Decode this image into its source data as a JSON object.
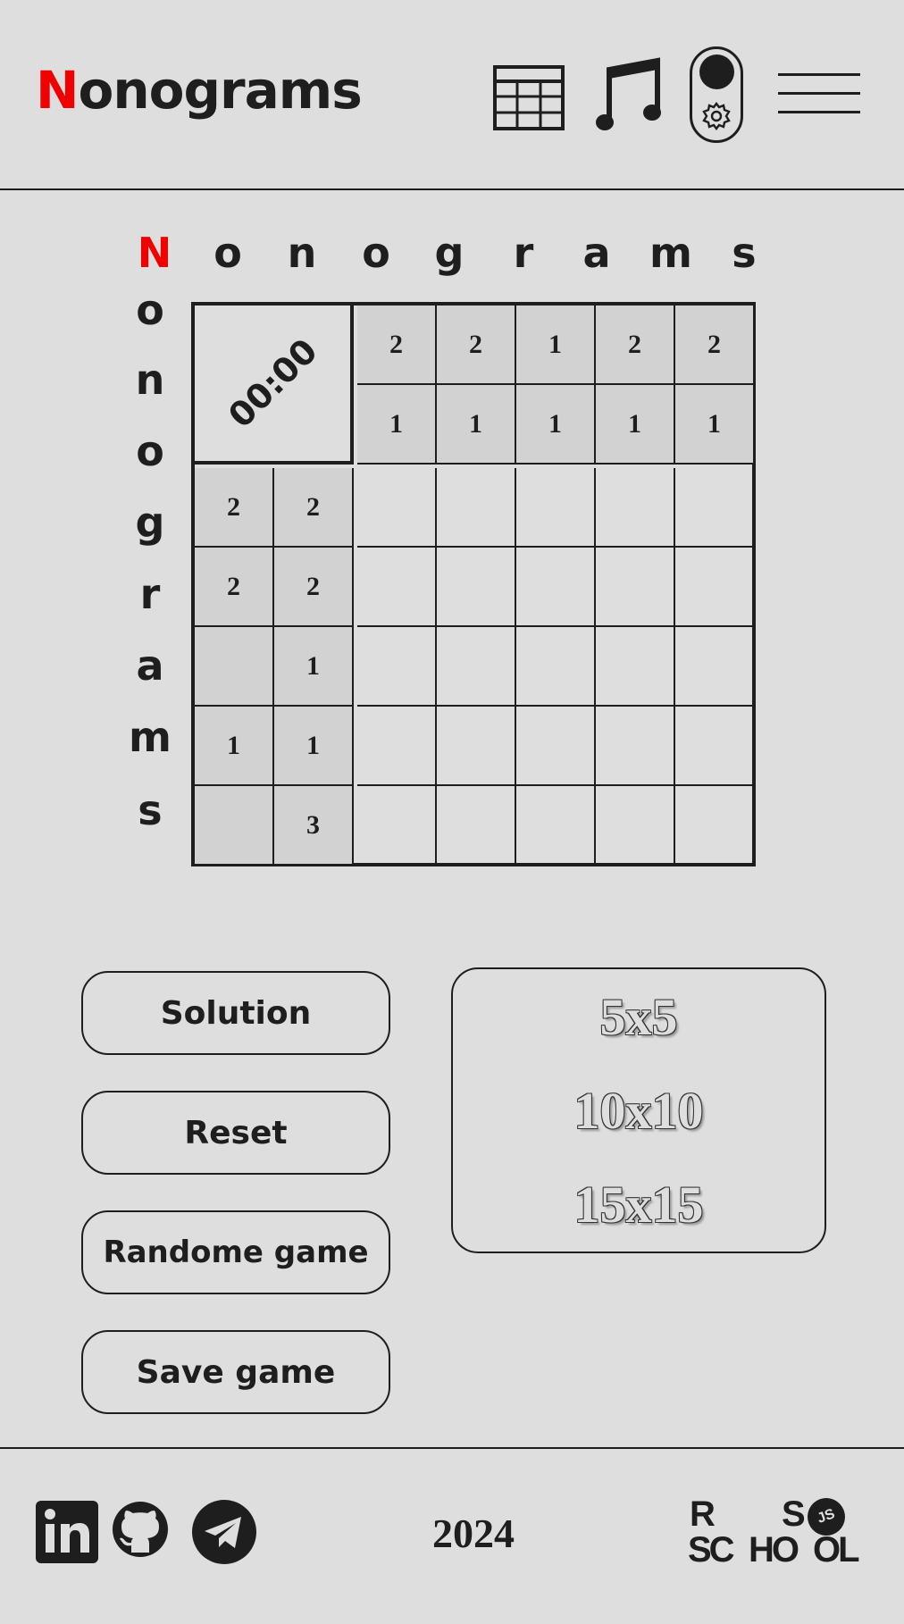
{
  "header": {
    "logo_first": "N",
    "logo_rest": "onograms",
    "icons": [
      "table-icon",
      "music-icon",
      "theme-toggle",
      "menu-icon"
    ]
  },
  "title_letters_top": [
    "N",
    "o",
    "n",
    "o",
    "g",
    "r",
    "a",
    "m",
    "s"
  ],
  "title_letters_side": [
    "o",
    "n",
    "o",
    "g",
    "r",
    "a",
    "m",
    "s"
  ],
  "game": {
    "timer": "00:00",
    "column_clues": [
      [
        "2",
        "1"
      ],
      [
        "2",
        "1"
      ],
      [
        "1",
        "1"
      ],
      [
        "2",
        "1"
      ],
      [
        "2",
        "1"
      ]
    ],
    "row_clues": [
      [
        "2",
        "2"
      ],
      [
        "2",
        "2"
      ],
      [
        "",
        "1"
      ],
      [
        "1",
        "1"
      ],
      [
        "",
        "3"
      ]
    ]
  },
  "buttons": {
    "solution": "Solution",
    "reset": "Reset",
    "random": "Randome game",
    "save": "Save game"
  },
  "sizes": [
    "5x5",
    "10x10",
    "15x15"
  ],
  "footer": {
    "year": "2024",
    "social": [
      "linkedin-icon",
      "github-icon",
      "telegram-icon"
    ],
    "rs_logo": {
      "r": "R",
      "s": "S",
      "school_1": "SC",
      "school_2": "HO",
      "school_3": "OL",
      "js": "JS"
    }
  },
  "colors": {
    "accent": "#f00000",
    "background": "#dedede",
    "clue_bg": "#d2d2d2",
    "ink": "#1e1e1e"
  }
}
